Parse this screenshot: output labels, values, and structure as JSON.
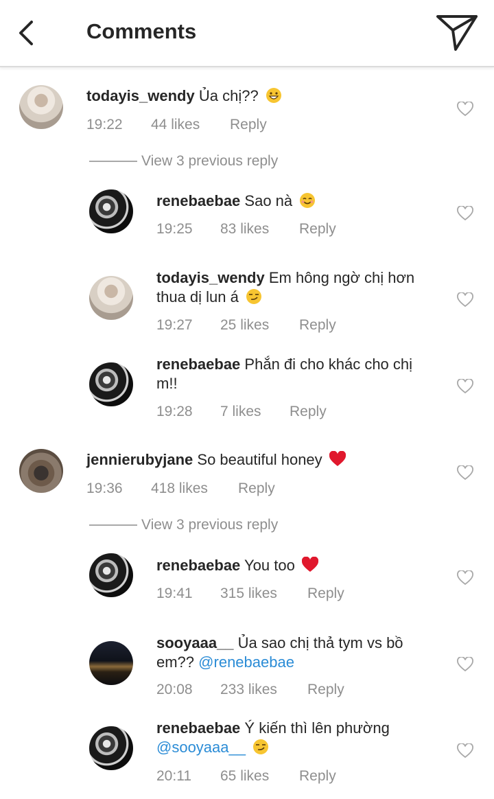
{
  "header": {
    "title": "Comments"
  },
  "view_previous_label": "View 3 previous reply",
  "meta": {
    "reply_label": "Reply"
  },
  "comments": [
    {
      "user": "todayis_wendy",
      "text1": "Ủa chị??",
      "text2": "",
      "time": "19:22",
      "likes": "44 likes",
      "emoji": "grin"
    },
    {
      "user": "renebaebae",
      "text1": "Sao nà",
      "text2": "",
      "time": "19:25",
      "likes": "83 likes",
      "emoji": "smile"
    },
    {
      "user": "todayis_wendy",
      "text1": "Em hông ngờ chị hơn",
      "text2": "thua dị lun á",
      "time": "19:27",
      "likes": "25 likes",
      "emoji": "smirk"
    },
    {
      "user": "renebaebae",
      "text1": "Phắn đi cho khác cho chị",
      "text2": "m!!",
      "time": "19:28",
      "likes": "7 likes"
    },
    {
      "user": "jennierubyjane",
      "text1": "So beautiful honey",
      "text2": "",
      "time": "19:36",
      "likes": "418 likes",
      "emoji": "heart"
    },
    {
      "user": "renebaebae",
      "text1": "You too",
      "text2": "",
      "time": "19:41",
      "likes": "315 likes",
      "emoji": "heart"
    },
    {
      "user": "sooyaaa__",
      "text1": "Ủa sao chị thả tym vs bồ",
      "text2": "em??",
      "mention": "@renebaebae",
      "time": "20:08",
      "likes": "233 likes"
    },
    {
      "user": "renebaebae",
      "text1": "Ý kiến thì lên phường",
      "text2": "",
      "mention": "@sooyaaa__",
      "time": "20:11",
      "likes": "65 likes",
      "emoji": "smirk"
    }
  ]
}
